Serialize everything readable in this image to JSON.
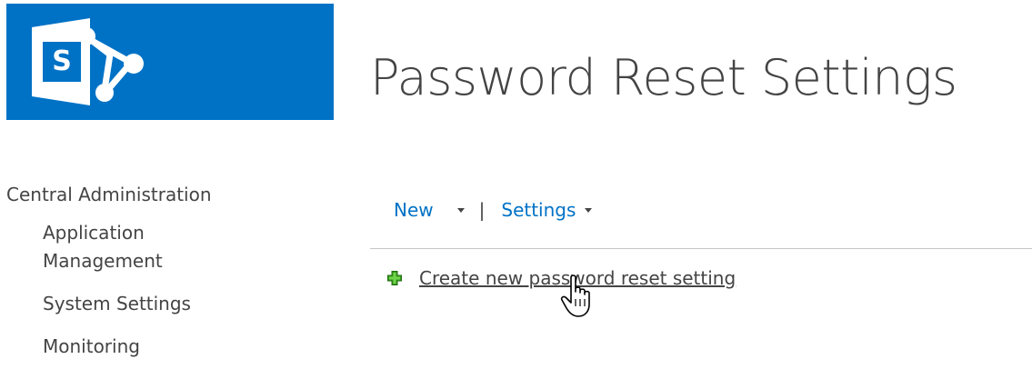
{
  "app": {
    "brand_color": "#0072c6",
    "logo_letter": "S"
  },
  "header": {
    "title": "Password Reset Settings"
  },
  "quicklaunch": {
    "heading": "Central Administration",
    "items": [
      {
        "label": "Application Management"
      },
      {
        "label": "System Settings"
      },
      {
        "label": "Monitoring"
      }
    ]
  },
  "toolbar": {
    "new_label": "New",
    "separator": "|",
    "settings_label": "Settings"
  },
  "content": {
    "create_link": "Create new password reset setting",
    "create_icon": "plus-icon",
    "cursor_icon": "hand-pointer-icon"
  }
}
